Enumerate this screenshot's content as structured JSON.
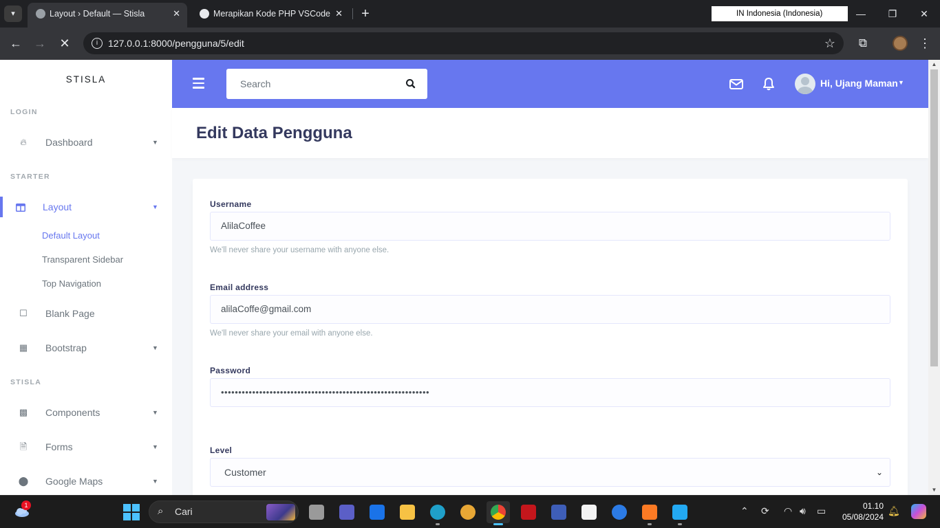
{
  "browser": {
    "tabs": [
      {
        "title": "Layout › Default — Stisla",
        "active": true
      },
      {
        "title": "Merapikan Kode PHP VSCode",
        "active": false
      }
    ],
    "ime_label": "IN  Indonesia (Indonesia)",
    "url": "127.0.0.1:8000/pengguna/5/edit"
  },
  "sidebar": {
    "brand": "STISLA",
    "headers": {
      "login": "LOGIN",
      "starter": "STARTER",
      "stisla": "STISLA"
    },
    "items": {
      "dashboard": "Dashboard",
      "layout": "Layout",
      "blank_page": "Blank Page",
      "bootstrap": "Bootstrap",
      "components": "Components",
      "forms": "Forms",
      "google_maps": "Google Maps"
    },
    "layout_sub": [
      "Default Layout",
      "Transparent Sidebar",
      "Top Navigation"
    ]
  },
  "topnav": {
    "search_placeholder": "Search",
    "user_greeting": "Hi, Ujang Maman"
  },
  "page": {
    "title": "Edit Data Pengguna",
    "form": {
      "username_label": "Username",
      "username_value": "AlilaCoffee",
      "username_help": "We'll never share your username with anyone else.",
      "email_label": "Email address",
      "email_value": "alilaCoffe@gmail.com",
      "email_help": "We'll never share your email with anyone else.",
      "password_label": "Password",
      "password_value": "••••••••••••••••••••••••••••••••••••••••••••••••••••••••••••",
      "level_label": "Level",
      "level_value": "Customer"
    }
  },
  "taskbar": {
    "search_text": "Cari",
    "notification_count": "1",
    "time": "01.10",
    "date": "05/08/2024"
  },
  "colors": {
    "primary": "#6777ef",
    "heading": "#34395e",
    "muted": "#98a6ad"
  }
}
